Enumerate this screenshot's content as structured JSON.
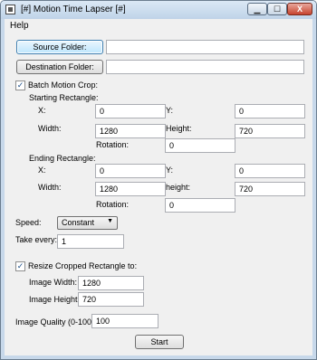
{
  "window": {
    "title": "[#] Motion Time Lapser [#]",
    "min_glyph": "▁",
    "max_glyph": "☐",
    "close_glyph": "X"
  },
  "menu": {
    "help": "Help"
  },
  "source": {
    "button": "Source Folder:",
    "value": ""
  },
  "destination": {
    "button": "Destination Folder:",
    "value": ""
  },
  "batch_crop": {
    "label": "Batch Motion Crop:",
    "checked": true,
    "starting": {
      "heading": "Starting Rectangle:",
      "x_label": "X:",
      "x": "0",
      "y_label": "Y:",
      "y": "0",
      "width_label": "Width:",
      "width": "1280",
      "height_label": "Height:",
      "height": "720",
      "rotation_label": "Rotation:",
      "rotation": "0"
    },
    "ending": {
      "heading": "Ending Rectangle:",
      "x_label": "X:",
      "x": "0",
      "y_label": "Y:",
      "y": "0",
      "width_label": "Width:",
      "width": "1280",
      "height_label": "height:",
      "height": "720",
      "rotation_label": "Rotation:",
      "rotation": "0"
    }
  },
  "speed": {
    "label": "Speed:",
    "value": "Constant"
  },
  "take_every": {
    "label": "Take every:",
    "value": "1"
  },
  "resize": {
    "label": "Resize Cropped Rectangle to:",
    "checked": true,
    "width_label": "Image Width:",
    "width": "1280",
    "height_label": "Image Height:",
    "height": "720"
  },
  "quality": {
    "label": "Image Quality (0-100):",
    "value": "100"
  },
  "start_button": "Start",
  "check_glyph": "✓",
  "arrow_glyph": "▼"
}
